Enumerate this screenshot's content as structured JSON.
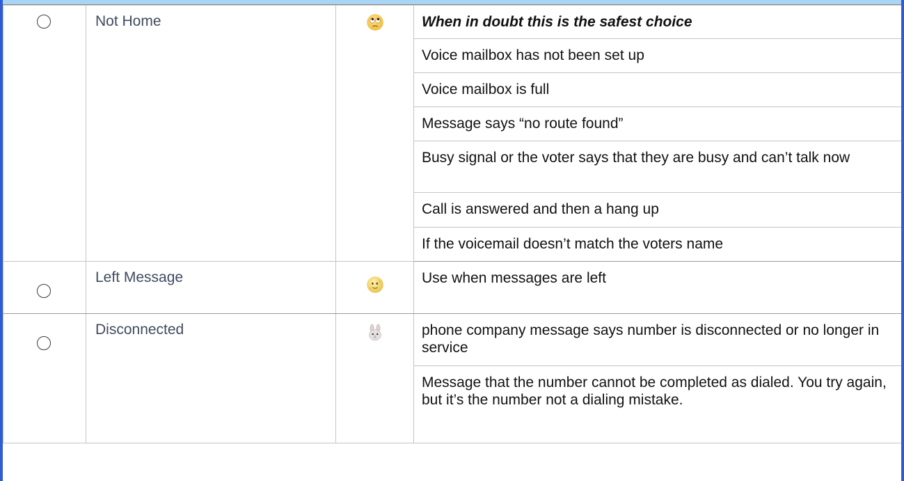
{
  "dispositions": [
    {
      "label": "Not Home",
      "icon": "face-with-rolling-eyes-icon",
      "selected": false,
      "descriptions": [
        "When in doubt this is the safest choice",
        "Voice mailbox has not been set up",
        "Voice mailbox is full",
        "Message says “no route found”",
        "Busy signal or the voter says that they are busy and can’t talk now",
        "Call is answered and then a hang up",
        "If the voicemail doesn’t match the voters name"
      ]
    },
    {
      "label": "Left Message",
      "icon": "moon-face-icon",
      "selected": false,
      "descriptions": [
        "Use when messages are left"
      ]
    },
    {
      "label": "Disconnected",
      "icon": "rabbit-face-icon",
      "selected": false,
      "descriptions": [
        "phone company message says number is disconnected or no longer in service",
        "Message that the number cannot be completed as dialed.  You try again, but it’s the number not a dialing mistake."
      ]
    }
  ],
  "colors": {
    "frame_border": "#2f5bd3",
    "top_band": "#a9d4f3",
    "label_text": "#3f4a5e"
  }
}
